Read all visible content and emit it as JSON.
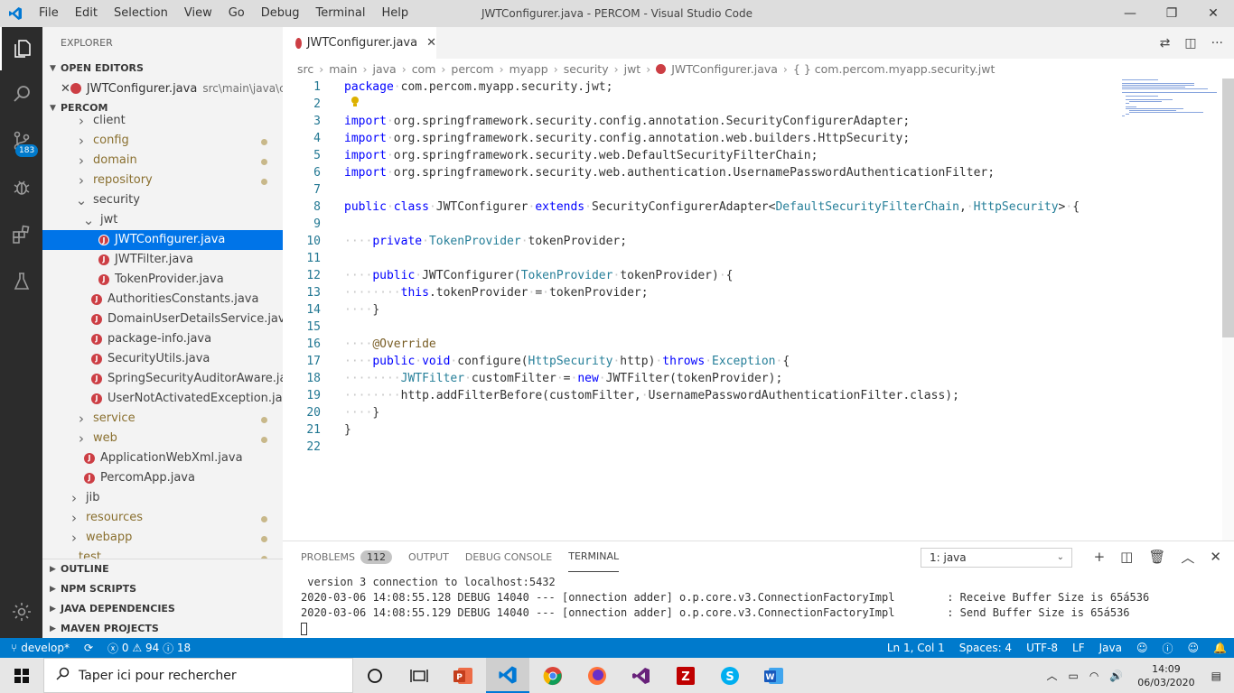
{
  "window": {
    "title": "JWTConfigurer.java - PERCOM - Visual Studio Code",
    "menu": [
      "File",
      "Edit",
      "Selection",
      "View",
      "Go",
      "Debug",
      "Terminal",
      "Help"
    ],
    "controls": {
      "minimize": "—",
      "maximize": "❐",
      "close": "✕"
    }
  },
  "activity_bar": {
    "items": [
      "explorer-icon",
      "search-icon",
      "source-control-icon",
      "debug-icon",
      "extensions-icon",
      "test-icon"
    ],
    "scm_badge": "183",
    "settings": "gear-icon"
  },
  "sidebar": {
    "title": "EXPLORER",
    "open_editors_header": "OPEN EDITORS",
    "open_editor": {
      "name": "JWTConfigurer.java",
      "path": "src\\main\\java\\c..."
    },
    "project_header": "PERCOM",
    "tree": [
      {
        "label": "client",
        "kind": "folder",
        "depth": 0,
        "dot": false
      },
      {
        "label": "config",
        "kind": "folder",
        "depth": 0,
        "dot": true
      },
      {
        "label": "domain",
        "kind": "folder",
        "depth": 0,
        "dot": true
      },
      {
        "label": "repository",
        "kind": "folder",
        "depth": 0,
        "dot": true
      },
      {
        "label": "security",
        "kind": "folder-open",
        "depth": 0,
        "dot": false
      },
      {
        "label": "jwt",
        "kind": "folder-open",
        "depth": 1,
        "dot": false
      },
      {
        "label": "JWTConfigurer.java",
        "kind": "java",
        "depth": 2,
        "dot": false,
        "selected": true
      },
      {
        "label": "JWTFilter.java",
        "kind": "java",
        "depth": 2,
        "dot": false
      },
      {
        "label": "TokenProvider.java",
        "kind": "java",
        "depth": 2,
        "dot": false
      },
      {
        "label": "AuthoritiesConstants.java",
        "kind": "java",
        "depth": 1,
        "dot": false
      },
      {
        "label": "DomainUserDetailsService.java",
        "kind": "java",
        "depth": 1,
        "dot": false
      },
      {
        "label": "package-info.java",
        "kind": "java",
        "depth": 1,
        "dot": false
      },
      {
        "label": "SecurityUtils.java",
        "kind": "java",
        "depth": 1,
        "dot": false
      },
      {
        "label": "SpringSecurityAuditorAware.java",
        "kind": "java",
        "depth": 1,
        "dot": false
      },
      {
        "label": "UserNotActivatedException.java",
        "kind": "java",
        "depth": 1,
        "dot": false
      },
      {
        "label": "service",
        "kind": "folder",
        "depth": 0,
        "dot": true
      },
      {
        "label": "web",
        "kind": "folder",
        "depth": 0,
        "dot": true
      },
      {
        "label": "ApplicationWebXml.java",
        "kind": "java",
        "depth": 0,
        "dot": false
      },
      {
        "label": "PercomApp.java",
        "kind": "java",
        "depth": 0,
        "dot": false
      },
      {
        "label": "jib",
        "kind": "folder",
        "depth": -1,
        "dot": false
      },
      {
        "label": "resources",
        "kind": "folder",
        "depth": -1,
        "dot": true
      },
      {
        "label": "webapp",
        "kind": "folder",
        "depth": -1,
        "dot": true
      },
      {
        "label": "test",
        "kind": "folder-open",
        "depth": -2,
        "dot": true
      }
    ],
    "lower_sections": [
      "OUTLINE",
      "NPM SCRIPTS",
      "JAVA DEPENDENCIES",
      "MAVEN PROJECTS"
    ]
  },
  "editor": {
    "tab": {
      "label": "JWTConfigurer.java"
    },
    "breadcrumb": [
      "src",
      "main",
      "java",
      "com",
      "percom",
      "myapp",
      "security",
      "jwt",
      "JWTConfigurer.java",
      "{ } com.percom.myapp.security.jwt"
    ],
    "lines": [
      [
        [
          "kw",
          "package"
        ],
        [
          "",
          "·com.percom.myapp.security.jwt;"
        ]
      ],
      [],
      [
        [
          "kw",
          "import"
        ],
        [
          "",
          "·org.springframework.security.config.annotation.SecurityConfigurerAdapter;"
        ]
      ],
      [
        [
          "kw",
          "import"
        ],
        [
          "",
          "·org.springframework.security.config.annotation.web.builders.HttpSecurity;"
        ]
      ],
      [
        [
          "kw",
          "import"
        ],
        [
          "",
          "·org.springframework.security.web.DefaultSecurityFilterChain;"
        ]
      ],
      [
        [
          "kw",
          "import"
        ],
        [
          "",
          "·org.springframework.security.web.authentication.UsernamePasswordAuthenticationFilter;"
        ]
      ],
      [],
      [
        [
          "kw",
          "public"
        ],
        [
          "",
          "·"
        ],
        [
          "kw",
          "class"
        ],
        [
          "",
          "·JWTConfigurer·"
        ],
        [
          "kw",
          "extends"
        ],
        [
          "",
          "·SecurityConfigurerAdapter<"
        ],
        [
          "ty",
          "DefaultSecurityFilterChain"
        ],
        [
          "",
          ",·"
        ],
        [
          "ty",
          "HttpSecurity"
        ],
        [
          "",
          ">·{"
        ]
      ],
      [],
      [
        [
          "ws",
          "····"
        ],
        [
          "kw",
          "private"
        ],
        [
          "",
          "·"
        ],
        [
          "ty",
          "TokenProvider"
        ],
        [
          "",
          "·tokenProvider;"
        ]
      ],
      [],
      [
        [
          "ws",
          "····"
        ],
        [
          "kw",
          "public"
        ],
        [
          "",
          "·JWTConfigurer("
        ],
        [
          "ty",
          "TokenProvider"
        ],
        [
          "",
          "·tokenProvider)·{"
        ]
      ],
      [
        [
          "ws",
          "········"
        ],
        [
          "kw",
          "this"
        ],
        [
          "",
          ".tokenProvider·=·tokenProvider;"
        ]
      ],
      [
        [
          "ws",
          "····"
        ],
        [
          "",
          "}"
        ]
      ],
      [],
      [
        [
          "ws",
          "····"
        ],
        [
          "ann",
          "@Override"
        ]
      ],
      [
        [
          "ws",
          "····"
        ],
        [
          "kw",
          "public"
        ],
        [
          "",
          "·"
        ],
        [
          "kw",
          "void"
        ],
        [
          "",
          "·configure("
        ],
        [
          "ty",
          "HttpSecurity"
        ],
        [
          "",
          "·http)·"
        ],
        [
          "kw",
          "throws"
        ],
        [
          "",
          "·"
        ],
        [
          "ty",
          "Exception"
        ],
        [
          "",
          "·{"
        ]
      ],
      [
        [
          "ws",
          "········"
        ],
        [
          "ty",
          "JWTFilter"
        ],
        [
          "",
          "·customFilter·=·"
        ],
        [
          "kw",
          "new"
        ],
        [
          "",
          "·JWTFilter(tokenProvider);"
        ]
      ],
      [
        [
          "ws",
          "········"
        ],
        [
          "",
          "http.addFilterBefore(customFilter,·UsernamePasswordAuthenticationFilter.class);"
        ]
      ],
      [
        [
          "ws",
          "····"
        ],
        [
          "",
          "}"
        ]
      ],
      [
        [
          "",
          "}"
        ]
      ],
      []
    ],
    "line_numbers": [
      "1",
      "2",
      "3",
      "4",
      "5",
      "6",
      "7",
      "8",
      "9",
      "10",
      "11",
      "12",
      "13",
      "14",
      "15",
      "16",
      "17",
      "18",
      "19",
      "20",
      "21",
      "22"
    ]
  },
  "panel": {
    "tabs": [
      "PROBLEMS",
      "OUTPUT",
      "DEBUG CONSOLE",
      "TERMINAL"
    ],
    "problems_count": "112",
    "terminal_select": "1: java",
    "terminal_lines": [
      " version 3 connection to localhost:5432",
      "2020-03-06 14:08:55.128 DEBUG 14040 --- [onnection adder] o.p.core.v3.ConnectionFactoryImpl        : Receive Buffer Size is 65á536",
      "2020-03-06 14:08:55.129 DEBUG 14040 --- [onnection adder] o.p.core.v3.ConnectionFactoryImpl        : Send Buffer Size is 65á536"
    ]
  },
  "statusbar": {
    "branch": "develop*",
    "errors": "0",
    "warnings": "94",
    "infos": "18",
    "position": "Ln 1, Col 1",
    "spaces": "Spaces: 4",
    "encoding": "UTF-8",
    "eol": "LF",
    "language": "Java"
  },
  "taskbar": {
    "search_placeholder": "Taper ici pour rechercher",
    "time": "14:09",
    "date": "06/03/2020",
    "apps": [
      "powerpoint-icon",
      "vscode-icon",
      "chrome-icon",
      "firefox-icon",
      "visual-studio-icon",
      "filezilla-icon",
      "skype-icon",
      "word-icon"
    ],
    "accent": "#0078d7"
  },
  "colors": {
    "statusbar": "#007acc",
    "selection": "#0074e8",
    "activitybar": "#2c2c2c"
  }
}
